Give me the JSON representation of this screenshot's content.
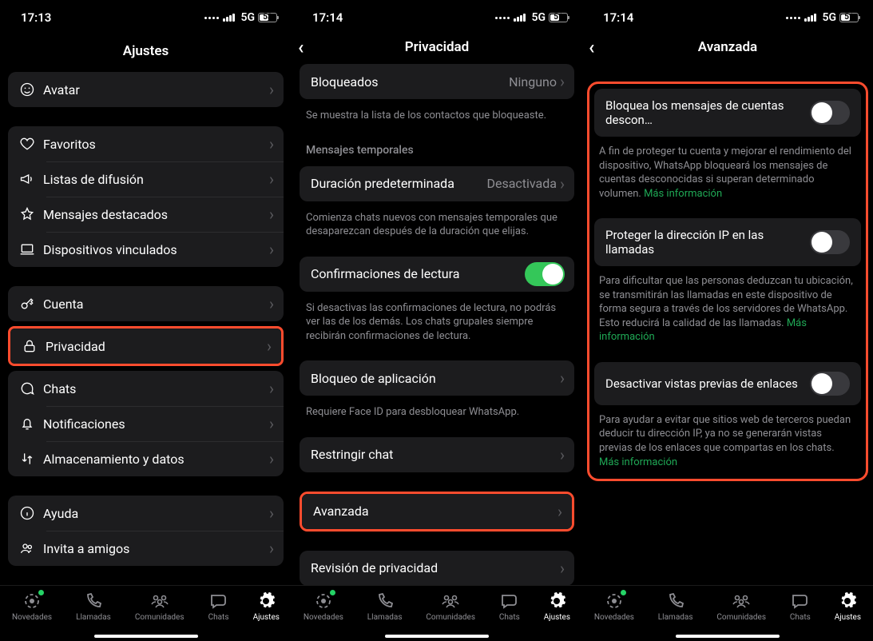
{
  "status": {
    "s1": {
      "time": "17:13",
      "net": "5G",
      "batt": "53"
    },
    "s2": {
      "time": "17:14",
      "net": "5G",
      "batt": "51"
    },
    "s3": {
      "time": "17:14",
      "net": "5G",
      "batt": "51"
    }
  },
  "screen1": {
    "title": "Ajustes",
    "avatar": "Avatar",
    "favoritos": "Favoritos",
    "listas": "Listas de difusión",
    "destacados": "Mensajes destacados",
    "dispositivos": "Dispositivos vinculados",
    "cuenta": "Cuenta",
    "privacidad": "Privacidad",
    "chats": "Chats",
    "notificaciones": "Notificaciones",
    "almacenamiento": "Almacenamiento y datos",
    "ayuda": "Ayuda",
    "invita": "Invita a amigos"
  },
  "screen2": {
    "title": "Privacidad",
    "bloqueados": "Bloqueados",
    "bloqueados_val": "Ninguno",
    "bloqueados_foot": "Se muestra la lista de los contactos que bloqueaste.",
    "temp_header": "Mensajes temporales",
    "duracion": "Duración predeterminada",
    "duracion_val": "Desactivada",
    "duracion_foot": "Comienza chats nuevos con mensajes temporales que desaparezcan después de la duración que elijas.",
    "confirmaciones": "Confirmaciones de lectura",
    "confirmaciones_foot": "Si desactivas las confirmaciones de lectura, no podrás ver las de los demás. Los chats grupales siempre recibirán confirmaciones de lectura.",
    "bloqueo_app": "Bloqueo de aplicación",
    "bloqueo_app_foot": "Requiere Face ID para desbloquear WhatsApp.",
    "restringir": "Restringir chat",
    "avanzada": "Avanzada",
    "revision": "Revisión de privacidad"
  },
  "screen3": {
    "title": "Avanzada",
    "row1": "Bloquea los mensajes de cuentas descon…",
    "foot1": "A fin de proteger tu cuenta y mejorar el rendimiento del dispositivo, WhatsApp bloqueará los mensajes de cuentas desconocidas si superan determinado volumen. ",
    "more": "Más información",
    "row2": "Proteger la dirección IP en las llamadas",
    "foot2": "Para dificultar que las personas deduzcan tu ubicación, se transmitirán las llamadas en este dispositivo de forma segura a través de los servidores de WhatsApp. Esto reducirá la calidad de las llamadas. ",
    "row3": "Desactivar vistas previas de enlaces",
    "foot3": "Para ayudar a evitar que sitios web de terceros puedan deducir tu dirección IP, ya no se generarán vistas previas de los enlaces que compartas en los chats. "
  },
  "tabs": {
    "novedades": "Novedades",
    "llamadas": "Llamadas",
    "comunidades": "Comunidades",
    "chats": "Chats",
    "ajustes": "Ajustes"
  }
}
